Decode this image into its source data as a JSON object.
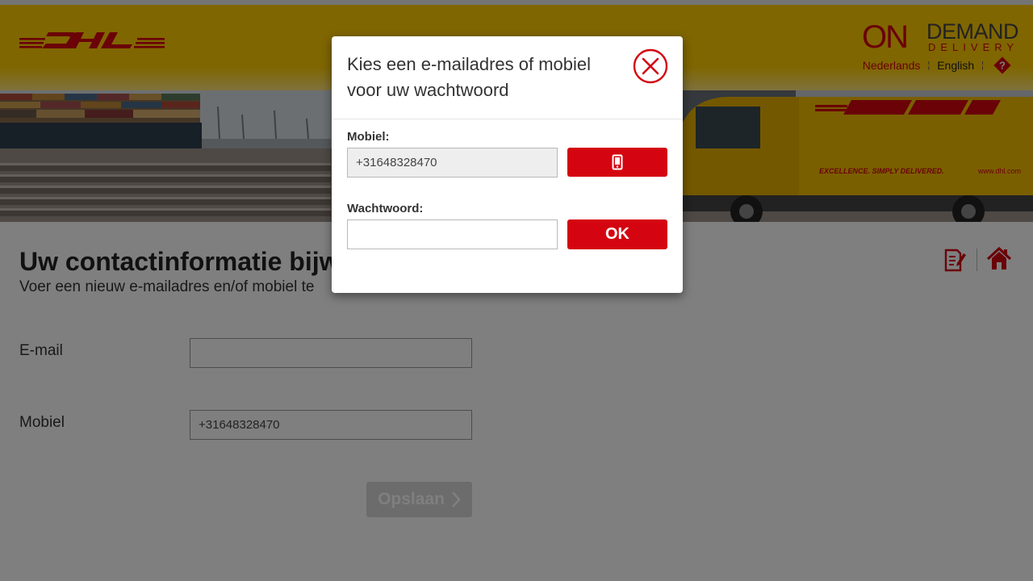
{
  "header": {
    "brand_logo_alt": "DHL",
    "od_logo": {
      "on": "ON",
      "demand": "DEMAND",
      "delivery": "DELIVERY"
    },
    "languages": [
      "Nederlands",
      "English"
    ],
    "language_separator": "¦"
  },
  "hero": {
    "truck_slogan": "EXCELLENCE. SIMPLY DELIVERED.",
    "truck_url": "www.dhl.com"
  },
  "main": {
    "title": "Uw contactinformatie bijwe",
    "subtitle": "Voer een nieuw e-mailadres en/of mobiel te",
    "email_label": "E-mail",
    "email_value": "",
    "mobile_label": "Mobiel",
    "mobile_value": "+31648328470",
    "save_label": "Opslaan"
  },
  "modal": {
    "title": "Kies een e-mailadres of mobiel voor uw wachtwoord",
    "mobile_label": "Mobiel:",
    "mobile_value": "+31648328470",
    "password_label": "Wachtwoord:",
    "password_value": "",
    "ok_label": "OK",
    "mobile_button_icon": "mobile-phone-icon"
  },
  "colors": {
    "brand_yellow": "#fecc00",
    "brand_red": "#d40511"
  }
}
